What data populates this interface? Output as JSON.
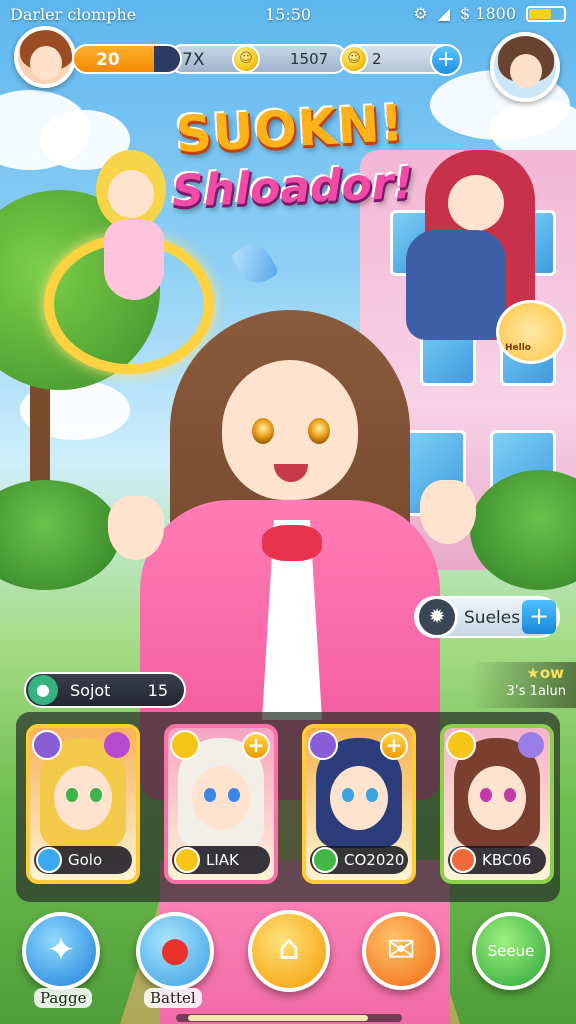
{
  "status_bar": {
    "left_text": "Darler clomphe",
    "time": "15:50",
    "money": "$ 1800"
  },
  "resources": {
    "level": "20",
    "multiplier": "7X",
    "gold": "1507",
    "gems": "2"
  },
  "title": {
    "line1": "SUOKN!",
    "line2": "Shloador!"
  },
  "side": {
    "skills_label": "Sueles",
    "spot_label": "Sojot",
    "spot_value": "15",
    "rating_top": "★ow",
    "rating_bottom": "3’s 1alun"
  },
  "mini_badge_text": "Hello",
  "cards": [
    {
      "name": "Golo",
      "frame_color": "#ffcc35",
      "element_color": "#3aa8f0",
      "hair_color": "#f3c94a",
      "eye_color": "#3ab54a",
      "bg": "#f7b25c"
    },
    {
      "name": "LIAK",
      "frame_color": "#ff6fa8",
      "element_color": "#f5c518",
      "hair_color": "#f2efe8",
      "eye_color": "#3a86e8",
      "bg": "#f5a4c4"
    },
    {
      "name": "CO2020",
      "frame_color": "#ffcc35",
      "element_color": "#43b649",
      "hair_color": "#2b3d7a",
      "eye_color": "#36a4e0",
      "bg": "#f3b24a"
    },
    {
      "name": "KBC06",
      "frame_color": "#8bd04a",
      "element_color": "#f06a3a",
      "hair_color": "#7a3f2e",
      "eye_color": "#c43aa8",
      "bg": "#f5b3c8"
    }
  ],
  "bottom_nav": {
    "pagge": "Pagge",
    "battel": "Battel",
    "go_label": "Seeue"
  },
  "colors": {
    "accent_orange": "#f48a00",
    "accent_pink": "#f04ba6",
    "accent_blue": "#1f8fe0",
    "accent_green": "#36b37e"
  },
  "icons": {
    "crystal": "crystal-icon",
    "apple": "apple-icon",
    "home": "home-icon",
    "mail": "mail-icon",
    "plus": "plus-icon"
  }
}
